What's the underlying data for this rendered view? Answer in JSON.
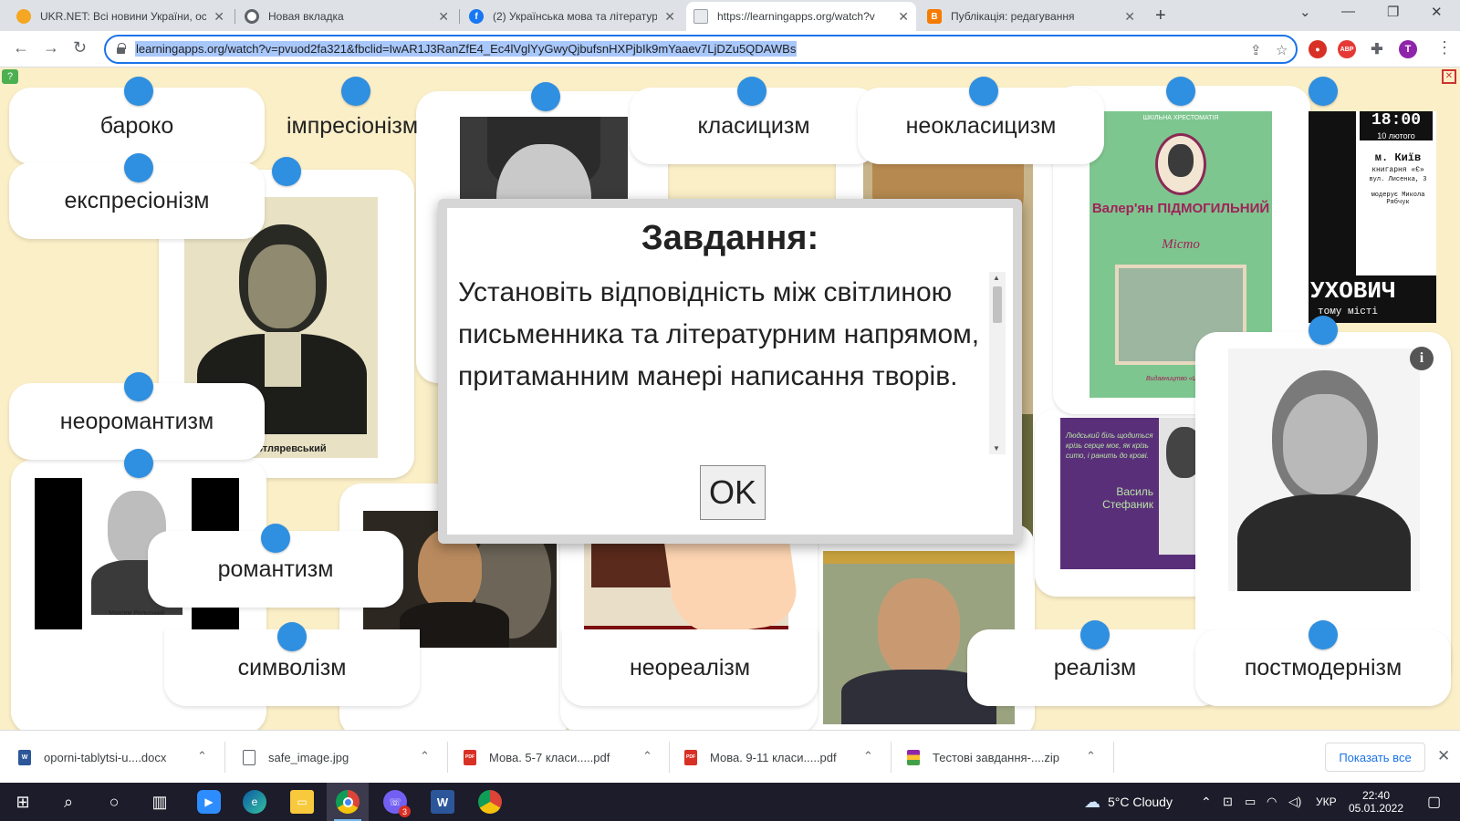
{
  "tabs": [
    {
      "title": "UKR.NET: Всі новини України, ос",
      "fav_color": "#f5a623",
      "fav_glyph": "",
      "active": false
    },
    {
      "title": "Новая вкладка",
      "fav_color": "#5f6368",
      "fav_glyph": "",
      "active": false
    },
    {
      "title": "(2) Українська мова та літератур",
      "fav_color": "#1877f2",
      "fav_glyph": "f",
      "active": false
    },
    {
      "title": "https://learningapps.org/watch?v",
      "fav_color": "#9aa0a6",
      "fav_glyph": "",
      "active": true
    },
    {
      "title": "Публікація: редагування",
      "fav_color": "#f57c00",
      "fav_glyph": "B",
      "active": false
    }
  ],
  "toolbar": {
    "url": "learningapps.org/watch?v=pvuod2fa321&fbclid=IwAR1J3RanZfE4_Ec4lVglYyGwyQjbufsnHXPjbIk9mYaaev7LjDZu5QDAWBs",
    "profile_letter": "T",
    "abp_label": "ABP"
  },
  "labels": {
    "baroko": "бароко",
    "impressionism": "імпресіонізм",
    "classicism": "класицизм",
    "neoclassicism": "неокласицизм",
    "expressionism": "експресіонізм",
    "neoromanticism": "неоромантизм",
    "romanticism": "романтизм",
    "symbolism": "символізм",
    "neorealism": "неореалізм",
    "realism": "реалізм",
    "postmodernism": "постмодернізм"
  },
  "photos": {
    "kotliarevsky_caption": "ич Котляревський",
    "rylsky_caption": "Максим Рильський",
    "book_top": "ШКІЛЬНА ХРЕСТОМАТІЯ",
    "book_author": "Валер'ян ПІДМОГИЛЬНИЙ",
    "book_title": "Місто",
    "book_publisher": "Видавництво «Школа»",
    "poster_time": "18:00",
    "poster_date": "10 лютого",
    "poster_city": "м. Київ",
    "poster_venue": "книгарня «Є»",
    "poster_addr": "вул. Лисенка, 3",
    "poster_mod": "модерує Микола Рябчук",
    "poster_name": "УХОВИЧ",
    "poster_sub": "тому місті",
    "stefanyk_quote": "Людський біль щодиться крізь серце моє, як крізь сито, і ранить до крові.",
    "stefanyk_name": "Василь Стефаник"
  },
  "modal": {
    "title": "Завдання:",
    "text": "Установіть відповідність між світлиною письменника та літературним напрямом, притаманним манері написання творів.",
    "ok": "OK"
  },
  "downloads": [
    {
      "name": "oporni-tablytsi-u....docx",
      "color": "#2b579a",
      "glyph": "W"
    },
    {
      "name": "safe_image.jpg",
      "color": "#5f6368",
      "glyph": ""
    },
    {
      "name": "Мова. 5-7 класи.....pdf",
      "color": "#d93025",
      "glyph": "PDF"
    },
    {
      "name": "Мова. 9-11 класи.....pdf",
      "color": "#d93025",
      "glyph": "PDF"
    },
    {
      "name": "Тестові завдання-....zip",
      "color": "#8e24aa",
      "glyph": ""
    }
  ],
  "downloads_show_all": "Показать все",
  "taskbar": {
    "weather": "5°C  Cloudy",
    "lang": "УКР",
    "time": "22:40",
    "date": "05.01.2022",
    "viber_badge": "3"
  }
}
